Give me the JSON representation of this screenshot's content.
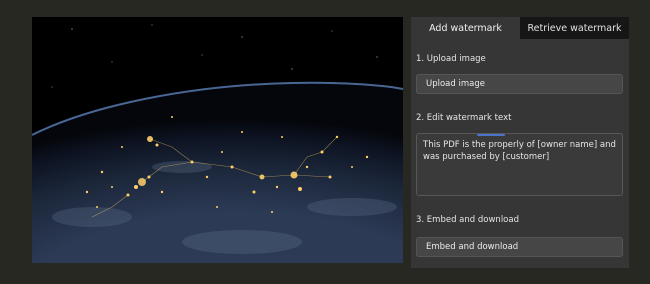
{
  "image": {
    "icon": "earth-night-lights-photo"
  },
  "tabs": [
    {
      "label": "Add watermark",
      "active": true
    },
    {
      "label": "Retrieve watermark",
      "active": false
    }
  ],
  "steps": {
    "upload": {
      "label": "1. Upload image",
      "button": "Upload image"
    },
    "edit": {
      "label": "2. Edit watermark text",
      "value": "This PDF is the properly of [owner name] and was purchased by [customer]"
    },
    "embed": {
      "label": "3. Embed and download",
      "button": "Embed and download"
    }
  },
  "colors": {
    "background": "#272822",
    "panel": "#363636",
    "inactive_tab": "#161616",
    "button": "#464646",
    "city_lights": "#ffcf6a"
  }
}
